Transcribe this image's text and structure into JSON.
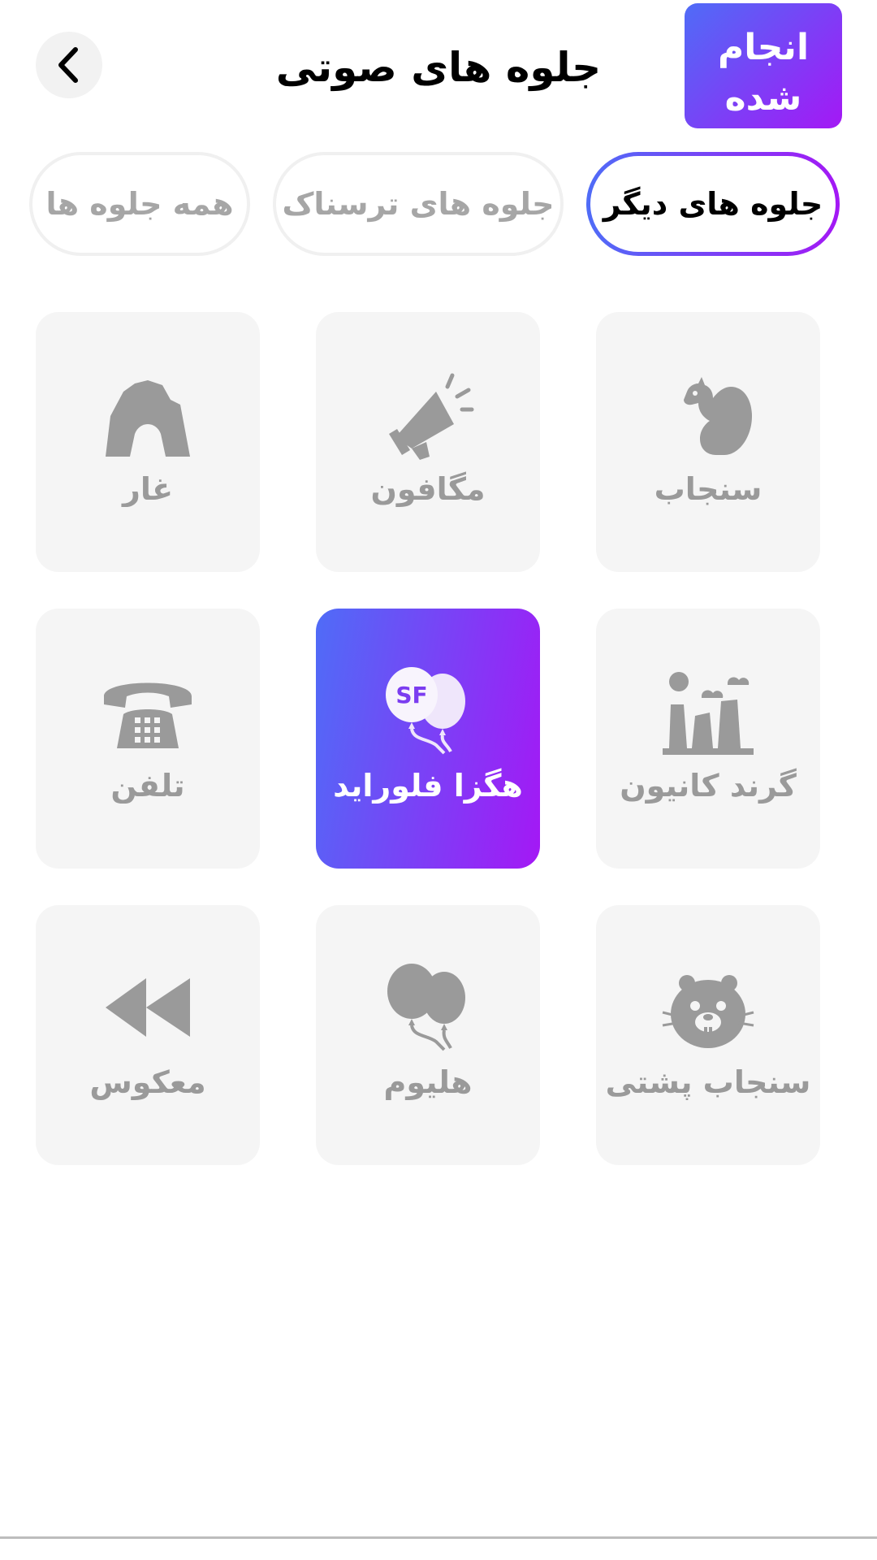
{
  "header": {
    "title": "جلوه های صوتی",
    "done_label": "انجام شده"
  },
  "tabs": [
    {
      "label": "جلوه های دیگر",
      "active": true
    },
    {
      "label": "جلوه های ترسناک",
      "active": false
    },
    {
      "label": "همه جلوه ها",
      "active": false
    }
  ],
  "effects": [
    {
      "label": "سنجاب",
      "icon": "squirrel-icon",
      "selected": false
    },
    {
      "label": "مگافون",
      "icon": "megaphone-icon",
      "selected": false
    },
    {
      "label": "غار",
      "icon": "cave-icon",
      "selected": false
    },
    {
      "label": "گرند کانیون",
      "icon": "grand-canyon-icon",
      "selected": false
    },
    {
      "label": "هگزا فلوراید",
      "icon": "sf-balloons-icon",
      "selected": true
    },
    {
      "label": "تلفن",
      "icon": "telephone-icon",
      "selected": false
    },
    {
      "label": "سنجاب پشتی",
      "icon": "groundhog-icon",
      "selected": false
    },
    {
      "label": "هلیوم",
      "icon": "balloons-icon",
      "selected": false
    },
    {
      "label": "معکوس",
      "icon": "rewind-icon",
      "selected": false
    }
  ],
  "colors": {
    "gradient_start": "#4f6cf7",
    "gradient_end": "#a418f5",
    "card_bg": "#f5f5f5",
    "icon_gray": "#9a9a9a"
  }
}
